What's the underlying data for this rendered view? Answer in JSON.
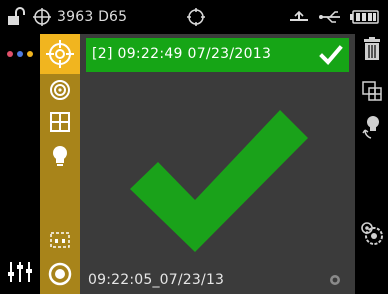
{
  "status_bar": {
    "lock_icon": "unlock-icon",
    "target_icon": "crosshair-plus-icon",
    "illuminant_text": "3963 D65",
    "sync_icon": "target-circle-icon",
    "signal_icon": "signal-icon",
    "usb_icon": "usb-icon",
    "battery_icon": "battery-icon"
  },
  "left_rail": {
    "dots_icon": "menu-dots-icon",
    "dots_colors": [
      "#e0506a",
      "#4d7be0",
      "#f1b51f"
    ],
    "adjust_icon": "sliders-icon"
  },
  "tools": [
    {
      "name": "target-tool",
      "icon": "crosshair-icon",
      "active": true
    },
    {
      "name": "sample-tool",
      "icon": "concentric-circles-icon",
      "active": false
    },
    {
      "name": "grid-tool",
      "icon": "grid-icon",
      "active": false
    },
    {
      "name": "lightbulb-tool",
      "icon": "lightbulb-icon",
      "active": false
    },
    {
      "name": "aperture-tool",
      "icon": "dashed-frame-icon",
      "active": false
    },
    {
      "name": "measure-tool",
      "icon": "record-icon",
      "active": false
    }
  ],
  "main": {
    "banner_text": "[2] 09:22:49 07/23/2013",
    "banner_color": "#16a516",
    "result_icon": "checkmark-icon",
    "check_color": "#1aa21a",
    "footer_text": "09:22:05_07/23/13",
    "footer_icon": "small-circle-icon"
  },
  "right_rail": {
    "delete_icon": "trash-icon",
    "compare_icon": "copy-compare-icon",
    "light_icon": "lightbulb-rotate-icon",
    "gear_icon": "gear-target-icon"
  }
}
